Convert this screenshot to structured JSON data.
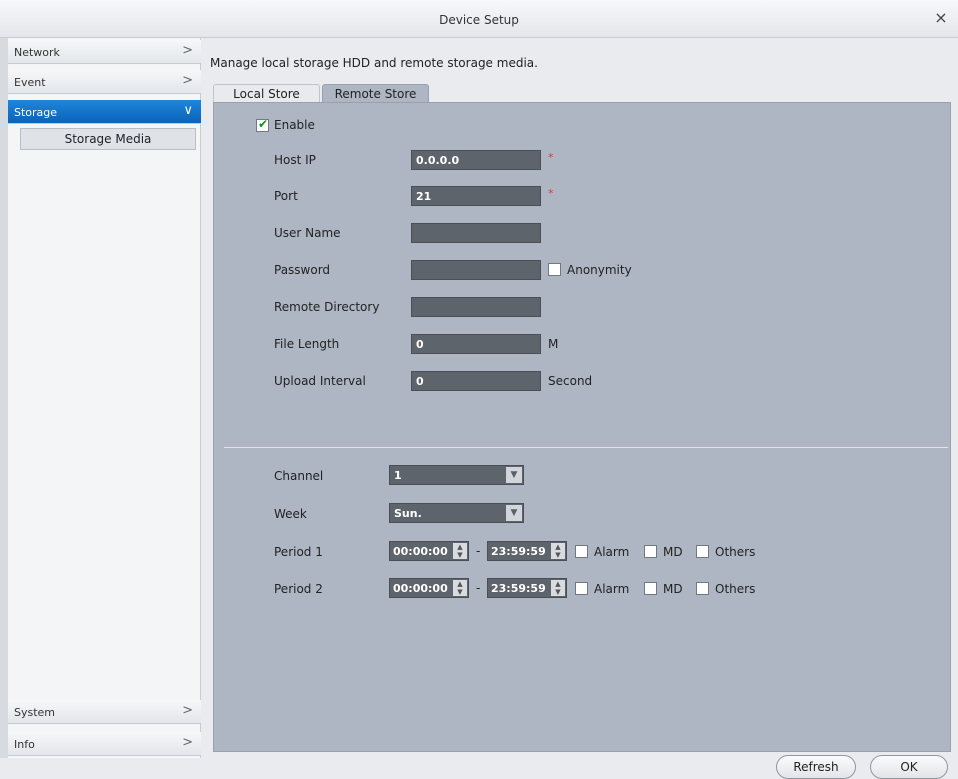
{
  "window": {
    "title": "Device Setup",
    "close_glyph": "×"
  },
  "sidebar": {
    "items": [
      {
        "label": "Network",
        "chev": ">"
      },
      {
        "label": "Event",
        "chev": ">"
      },
      {
        "label": "Storage",
        "chev": "∨"
      },
      {
        "label": "System",
        "chev": ">"
      },
      {
        "label": "Info",
        "chev": ">"
      }
    ],
    "sub_item": "Storage Media",
    "active": "Storage"
  },
  "main": {
    "description": "Manage local storage HDD and remote storage media.",
    "tabs": [
      {
        "label": "Local Store"
      },
      {
        "label": "Remote Store"
      }
    ],
    "active_tab": "Remote Store",
    "enable": {
      "label": "Enable",
      "checked": true
    },
    "fields": {
      "host_ip": {
        "label": "Host IP",
        "value": "0.0.0.0",
        "required": "*"
      },
      "port": {
        "label": "Port",
        "value": "21",
        "required": "*"
      },
      "user_name": {
        "label": "User Name",
        "value": ""
      },
      "password": {
        "label": "Password",
        "value": ""
      },
      "anonymity": {
        "label": "Anonymity",
        "checked": false
      },
      "remote_directory": {
        "label": "Remote Directory",
        "value": ""
      },
      "file_length": {
        "label": "File Length",
        "value": "0",
        "unit": "M"
      },
      "upload_interval": {
        "label": "Upload Interval",
        "value": "0",
        "unit": "Second"
      }
    },
    "channel": {
      "label": "Channel",
      "value": "1"
    },
    "week": {
      "label": "Week",
      "value": "Sun."
    },
    "periods": [
      {
        "label": "Period 1",
        "start": "00:00:00",
        "end": "23:59:59",
        "sep": "-",
        "alarm": "Alarm",
        "md": "MD",
        "others": "Others"
      },
      {
        "label": "Period 2",
        "start": "00:00:00",
        "end": "23:59:59",
        "sep": "-",
        "alarm": "Alarm",
        "md": "MD",
        "others": "Others"
      }
    ],
    "buttons": {
      "refresh": "Refresh",
      "ok": "OK"
    }
  },
  "colors": {
    "accent": "#0a63b8",
    "panel": "#adb6c2",
    "field": "#5e646c",
    "required": "#e03b3b",
    "check": "#1a8a1a"
  },
  "icons": {
    "close": "close-icon",
    "chevron_right": "chevron-right-icon",
    "chevron_down": "chevron-down-icon",
    "dropdown": "dropdown-arrow-icon",
    "spinner": "spinner-arrows-icon",
    "check": "checkmark-icon"
  }
}
